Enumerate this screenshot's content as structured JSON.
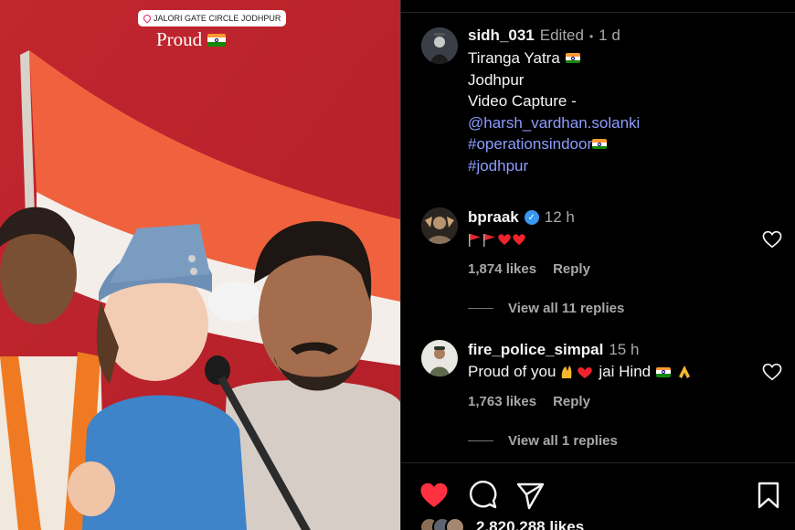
{
  "media": {
    "location_sticker": "JALORI GATE CIRCLE JODHPUR",
    "overlay_text": "Proud",
    "overlay_icon": "india-flag-icon"
  },
  "post": {
    "author": "sidh_031",
    "edited_label": "Edited",
    "separator": "•",
    "time_ago": "1 d",
    "caption_lines": [
      "Tiranga Yatra",
      "Jodhpur",
      "Video Capture -"
    ],
    "mention": "@harsh_vardhan.solanki",
    "hashtags": [
      "#operationsindoor",
      "#jodhpur"
    ]
  },
  "comments": [
    {
      "username": "bpraak",
      "verified": true,
      "time_ago": "12 h",
      "text_icons": [
        "red-flag-icon",
        "red-flag-icon",
        "red-heart-icon",
        "red-heart-icon"
      ],
      "likes": "1,874 likes",
      "reply_label": "Reply",
      "view_replies": "View all 11 replies"
    },
    {
      "username": "fire_police_simpal",
      "verified": false,
      "time_ago": "15 h",
      "text_before": "Proud of you",
      "text_after": "jai Hind",
      "likes": "1,763 likes",
      "reply_label": "Reply",
      "view_replies": "View all 1 replies"
    }
  ],
  "actions": {
    "like_icon": "filled-heart-icon",
    "comment_icon": "comment-bubble-icon",
    "share_icon": "paper-plane-icon",
    "save_icon": "bookmark-icon",
    "like_color": "#ff3040"
  },
  "likes_total": "2,820,288 likes",
  "colors": {
    "background": "#000000",
    "link": "#8d9cff",
    "muted": "#a8a8a8",
    "verified": "#3897f0"
  }
}
